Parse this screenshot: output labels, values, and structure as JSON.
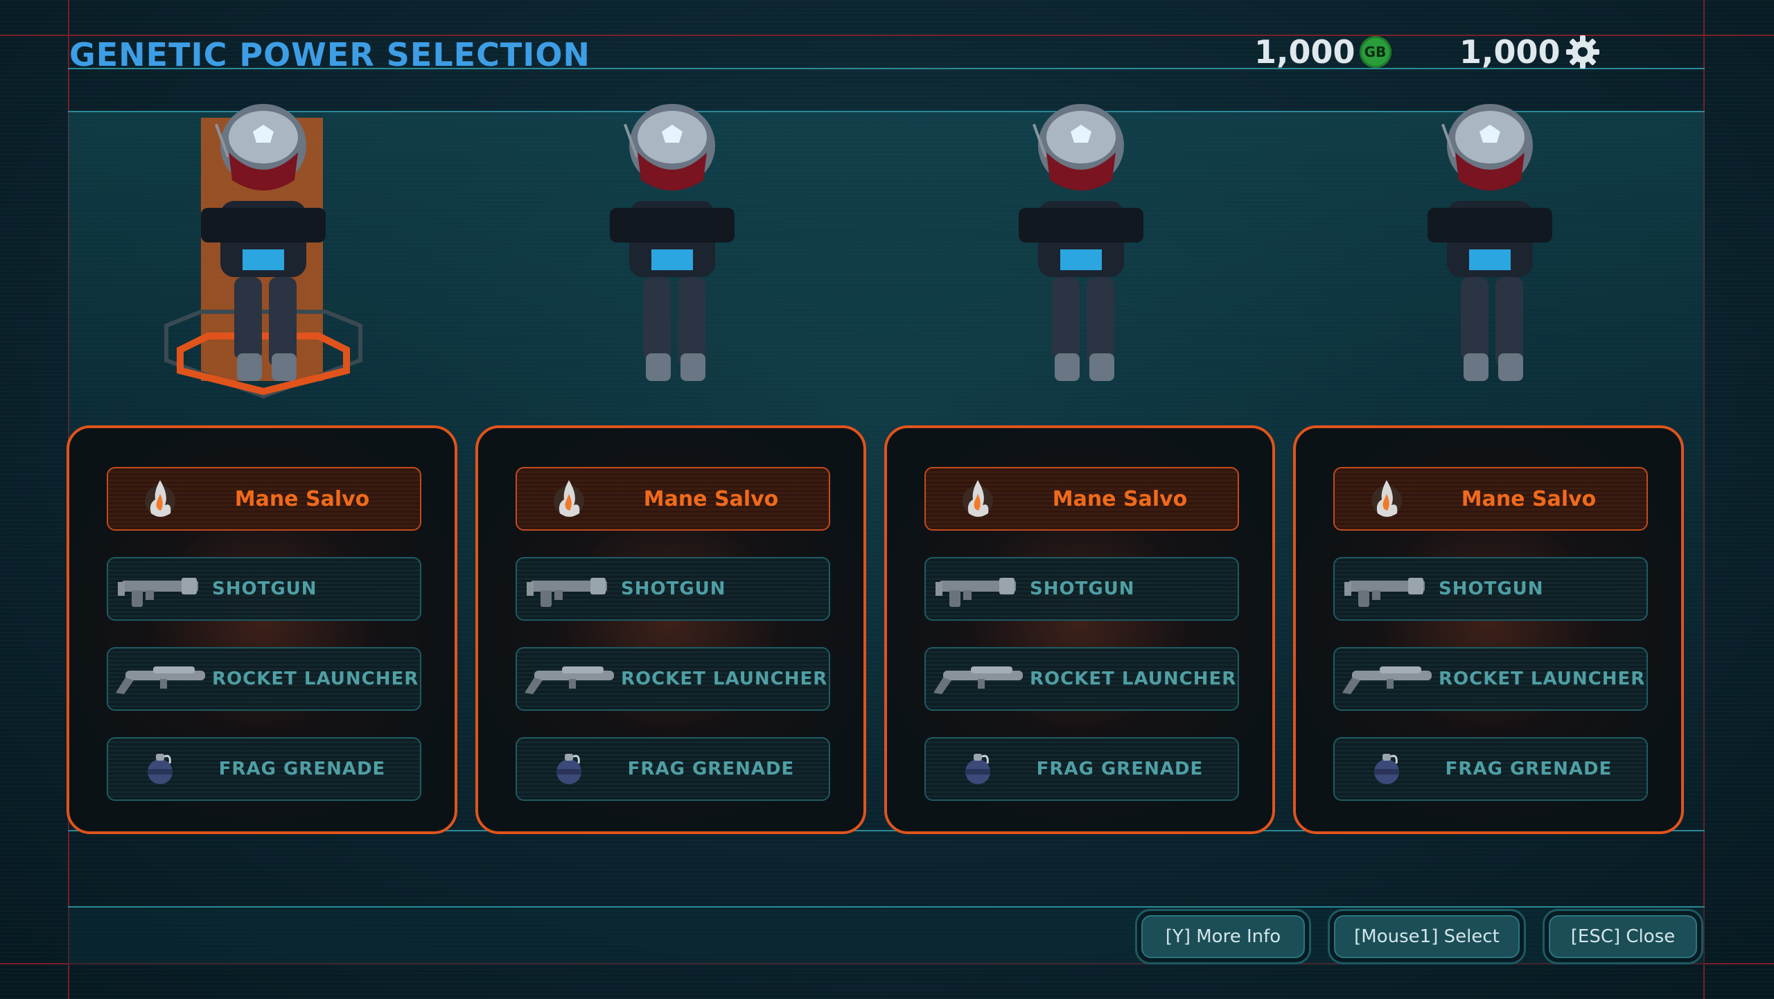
{
  "header": {
    "title": "GENETIC POWER SELECTION",
    "gb_amount": "1,000",
    "gb_badge": "GB",
    "gear_amount": "1,000"
  },
  "cards": [
    {
      "power": "Mane Salvo",
      "weapon1": "SHOTGUN",
      "weapon2": "ROCKET LAUNCHER",
      "grenade": "FRAG GRENADE",
      "selected": true
    },
    {
      "power": "Mane Salvo",
      "weapon1": "SHOTGUN",
      "weapon2": "ROCKET LAUNCHER",
      "grenade": "FRAG GRENADE",
      "selected": false
    },
    {
      "power": "Mane Salvo",
      "weapon1": "SHOTGUN",
      "weapon2": "ROCKET LAUNCHER",
      "grenade": "FRAG GRENADE",
      "selected": false
    },
    {
      "power": "Mane Salvo",
      "weapon1": "SHOTGUN",
      "weapon2": "ROCKET LAUNCHER",
      "grenade": "FRAG GRENADE",
      "selected": false
    }
  ],
  "footer": {
    "more_info": "[Y] More Info",
    "select": "[Mouse1] Select",
    "close": "[ESC] Close"
  },
  "colors": {
    "accent_orange": "#e0541c",
    "title_blue": "#3d9ee6",
    "teal_line": "#2a8a96",
    "gb_green": "#2a9d3a"
  }
}
